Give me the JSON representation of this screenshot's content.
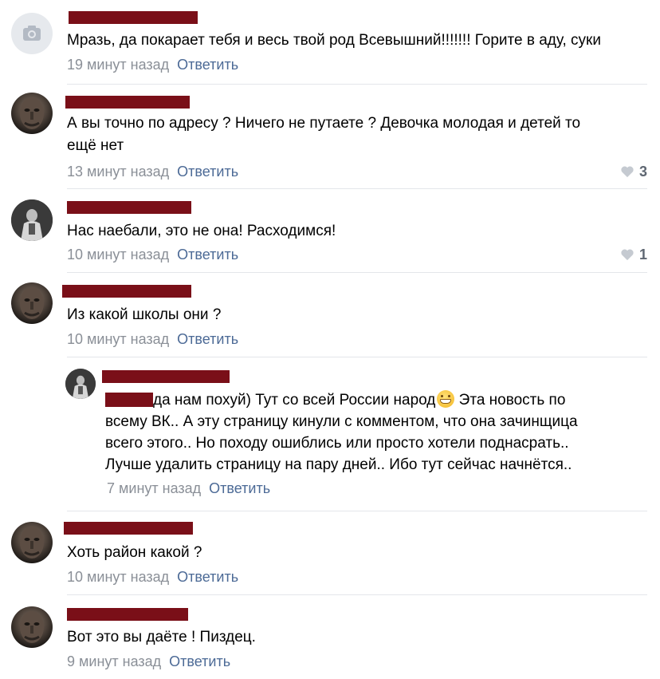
{
  "comments": [
    {
      "text_lines": [
        "Мразь, да покарает тебя и весь твой род Всевышний!!!!!!! Горите в аду, суки"
      ],
      "time": "19 минут назад",
      "reply_label": "Ответить"
    },
    {
      "text_lines": [
        "А вы точно по адресу ? Ничего не путаете ? Девочка молодая и детей то",
        "ещё нет"
      ],
      "time": "13 минут назад",
      "reply_label": "Ответить",
      "likes": "3"
    },
    {
      "text_lines": [
        "Нас наебали, это не она! Расходимся!"
      ],
      "time": "10 минут назад",
      "reply_label": "Ответить",
      "likes": "1"
    },
    {
      "text_lines": [
        "Из какой школы они ?"
      ],
      "time": "10 минут назад",
      "reply_label": "Ответить"
    },
    {
      "text_lines": [
        "да нам похуй) Тут со всей России народ",
        " Эта новость по",
        "всему ВК.. А эту страницу кинули с комментом, что она зачинщица",
        "всего этого.. Но походу ошиблись или просто хотели поднасрать..",
        "Лучше удалить страницу на пару дней.. Ибо тут сейчас начнётся.."
      ],
      "time": "7 минут назад",
      "reply_label": "Ответить"
    },
    {
      "text_lines": [
        "Хоть район какой ?"
      ],
      "time": "10 минут назад",
      "reply_label": "Ответить"
    },
    {
      "text_lines": [
        "Вот это вы даёте ! Пиздец."
      ],
      "time": "9 минут назад",
      "reply_label": "Ответить"
    }
  ],
  "icons": {
    "camera": "camera-icon",
    "heart": "heart-icon",
    "emoji": "grinning-emoji-icon"
  },
  "colors": {
    "link": "#4c6a96",
    "meta": "#8a8f97",
    "redaction": "#7a0f18",
    "divider": "#e4e6ea"
  }
}
